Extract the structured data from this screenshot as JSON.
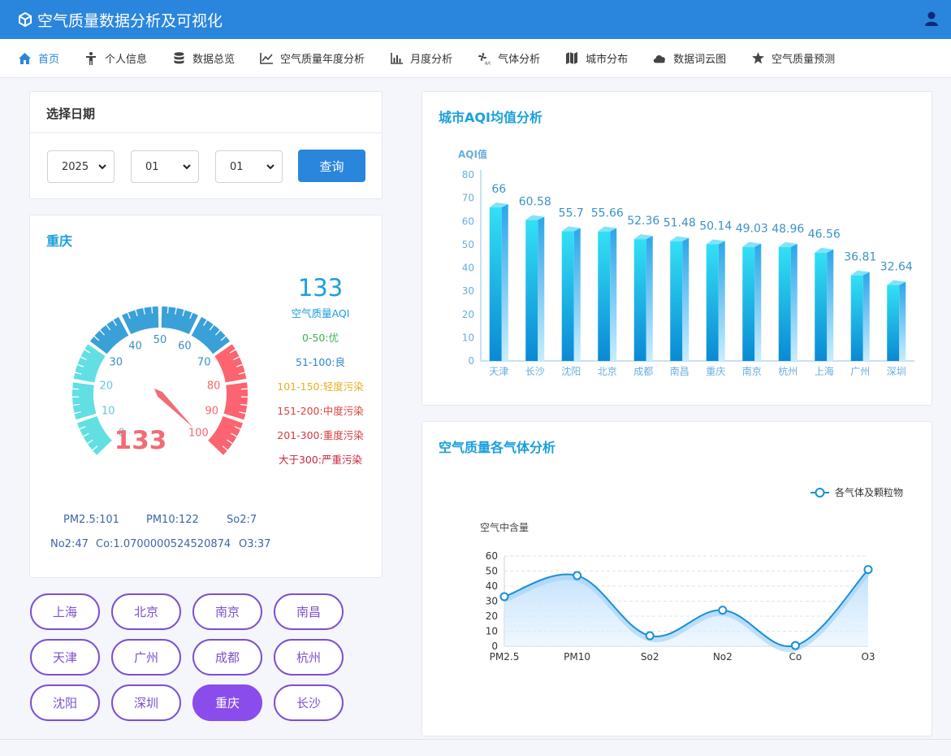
{
  "app": {
    "title": "空气质量数据分析及可视化"
  },
  "nav": [
    {
      "label": "首页",
      "icon": "home-icon",
      "active": true
    },
    {
      "label": "个人信息",
      "icon": "person-icon"
    },
    {
      "label": "数据总览",
      "icon": "database-icon"
    },
    {
      "label": "空气质量年度分析",
      "icon": "line-chart-icon"
    },
    {
      "label": "月度分析",
      "icon": "bar-chart-icon"
    },
    {
      "label": "气体分析",
      "icon": "fan-icon"
    },
    {
      "label": "城市分布",
      "icon": "map-icon"
    },
    {
      "label": "数据词云图",
      "icon": "cloud-icon"
    },
    {
      "label": "空气质量预测",
      "icon": "star-icon"
    }
  ],
  "date_panel": {
    "title": "选择日期",
    "year": "2025",
    "month": "01",
    "day": "01",
    "query_label": "查询"
  },
  "city_panel": {
    "city": "重庆",
    "aqi_value": "133",
    "aqi_label": "空气质量AQI",
    "levels": [
      {
        "text": "0-50:优",
        "color": "#3bb44a"
      },
      {
        "text": "51-100:良",
        "color": "#2e86c9"
      },
      {
        "text": "101-150:轻度污染",
        "color": "#e8b024"
      },
      {
        "text": "151-200:中度污染",
        "color": "#e0433c"
      },
      {
        "text": "201-300:重度污染",
        "color": "#d33b3b"
      },
      {
        "text": "大于300:严重污染",
        "color": "#c9283b"
      }
    ],
    "gauge": {
      "value": 133,
      "min": 0,
      "max": 100,
      "ticks": [
        "0",
        "10",
        "20",
        "30",
        "40",
        "50",
        "60",
        "70",
        "80",
        "90",
        "100"
      ],
      "display": "133"
    },
    "pollutants": {
      "pm25": "PM2.5:101",
      "pm10": "PM10:122",
      "so2": "So2:7",
      "no2": "No2:47",
      "co": "Co:1.0700000524520874",
      "o3": "O3:37"
    }
  },
  "cities": [
    {
      "label": "上海"
    },
    {
      "label": "北京"
    },
    {
      "label": "南京"
    },
    {
      "label": "南昌"
    },
    {
      "label": "天津"
    },
    {
      "label": "广州"
    },
    {
      "label": "成都"
    },
    {
      "label": "杭州"
    },
    {
      "label": "沈阳"
    },
    {
      "label": "深圳"
    },
    {
      "label": "重庆",
      "active": true
    },
    {
      "label": "长沙"
    }
  ],
  "chart_data": [
    {
      "type": "bar",
      "title": "城市AQI均值分析",
      "ylabel": "AQI值",
      "categories": [
        "天津",
        "长沙",
        "沈阳",
        "北京",
        "成都",
        "南昌",
        "重庆",
        "南京",
        "杭州",
        "上海",
        "广州",
        "深圳"
      ],
      "values": [
        66,
        60.58,
        55.7,
        55.66,
        52.36,
        51.48,
        50.14,
        49.03,
        48.96,
        46.56,
        36.81,
        32.64
      ],
      "yticks": [
        0,
        10,
        20,
        30,
        40,
        50,
        60,
        70,
        80
      ],
      "ylim": [
        0,
        80
      ],
      "grid": false
    },
    {
      "type": "area",
      "title": "空气质量各气体分析",
      "ylabel": "空气中含量",
      "legend": "各气体及颗粒物",
      "legend_position": "top-right",
      "categories": [
        "PM2.5",
        "PM10",
        "So2",
        "No2",
        "Co",
        "O3"
      ],
      "values": [
        33,
        47,
        7,
        24,
        0.5,
        51
      ],
      "yticks": [
        0,
        10,
        20,
        30,
        40,
        50,
        60
      ],
      "ylim": [
        0,
        60
      ],
      "grid": true
    }
  ]
}
